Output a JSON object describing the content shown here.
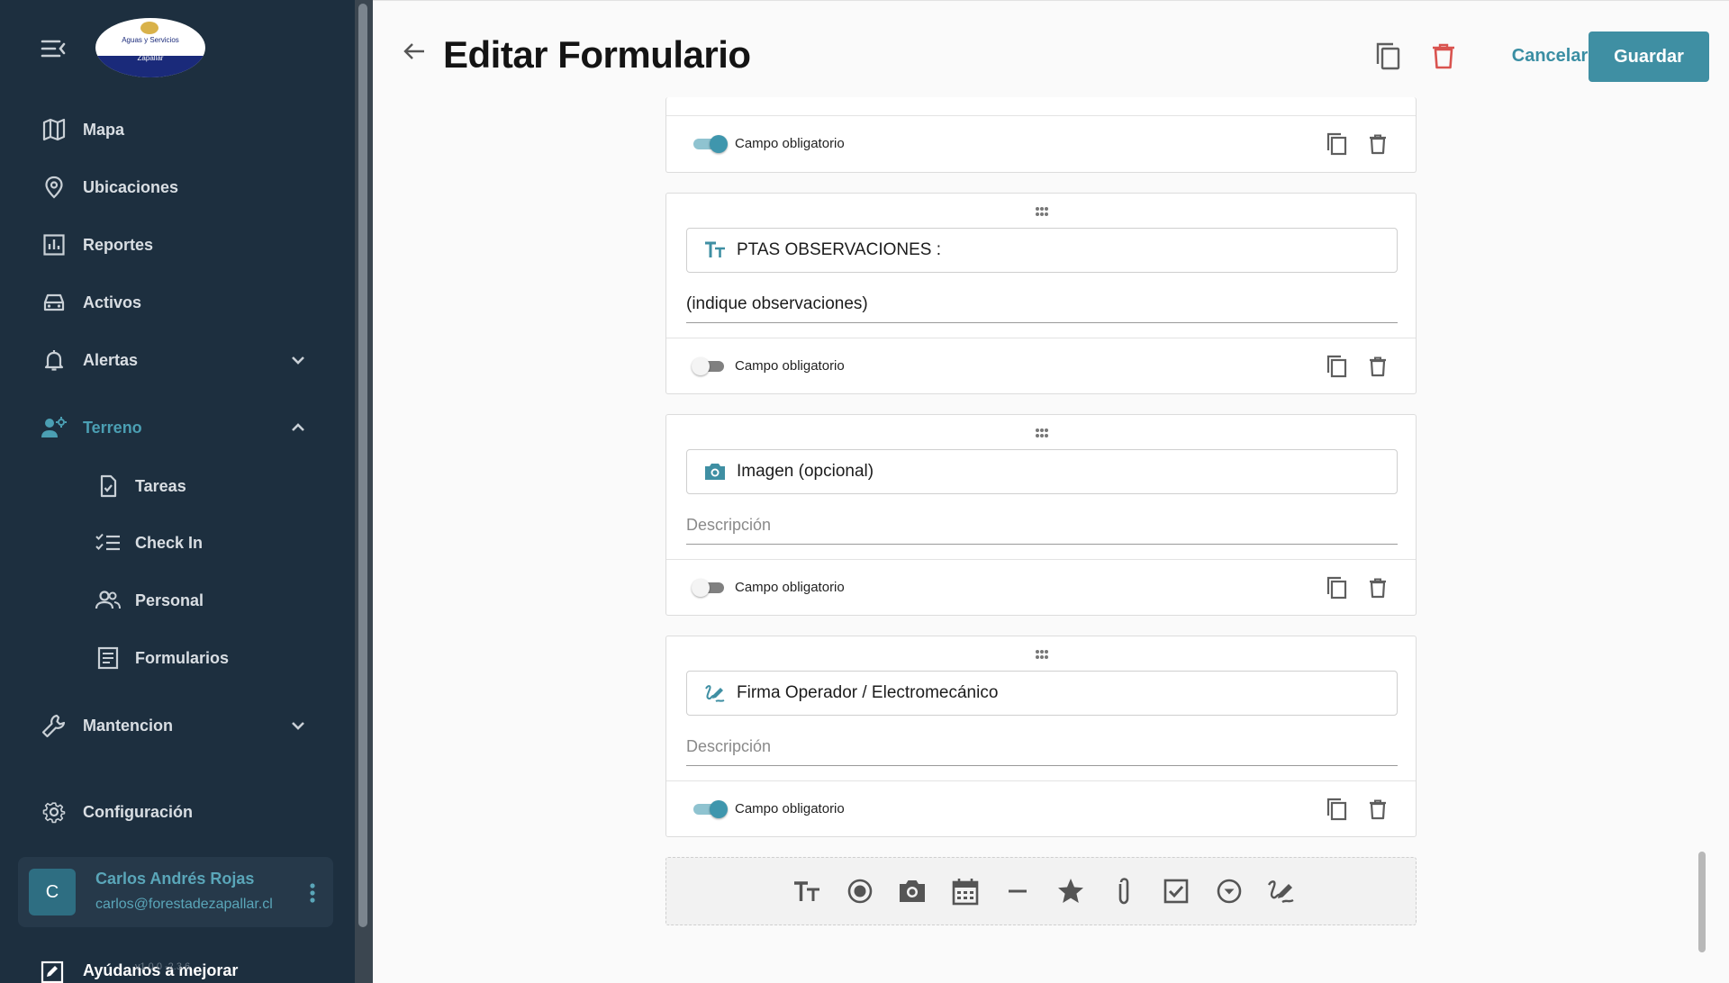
{
  "sidebar": {
    "logo": {
      "line1": "Aguas y Servicios",
      "line2": "Los Altos de",
      "line3": "Zapallar"
    },
    "nav": [
      {
        "label": "Mapa"
      },
      {
        "label": "Ubicaciones"
      },
      {
        "label": "Reportes"
      },
      {
        "label": "Activos"
      },
      {
        "label": "Alertas"
      },
      {
        "label": "Terreno"
      },
      {
        "label": "Tareas"
      },
      {
        "label": "Check In"
      },
      {
        "label": "Personal"
      },
      {
        "label": "Formularios"
      },
      {
        "label": "Mantencion"
      },
      {
        "label": "Configuración"
      }
    ],
    "user": {
      "initial": "C",
      "name": "Carlos Andrés Rojas",
      "email": "carlos@forestadezapallar.cl"
    },
    "help_label": "Ayúdanos a mejorar",
    "version": "v1.0.0 -2.3.6"
  },
  "header": {
    "title": "Editar Formulario",
    "cancel_label": "Cancelar",
    "save_label": "Guardar"
  },
  "form": {
    "required_label": "Campo obligatorio",
    "description_placeholder": "Descripción",
    "fields": [
      {
        "required": true
      },
      {
        "type": "text",
        "icon": "text-format-icon",
        "title": "PTAS OBSERVACIONES :",
        "description": "(indique observaciones)",
        "required": false
      },
      {
        "type": "image",
        "icon": "camera-icon",
        "title": "Imagen (opcional)",
        "description": "",
        "required": false
      },
      {
        "type": "signature",
        "icon": "signature-icon",
        "title": "Firma Operador / Electromecánico",
        "description": "",
        "required": true
      }
    ]
  },
  "toolbar": {
    "tools": [
      "text-format-icon",
      "radio-icon",
      "camera-icon",
      "calendar-icon",
      "divider-icon",
      "star-icon",
      "attachment-icon",
      "checkbox-icon",
      "dropdown-icon",
      "signature-icon"
    ]
  },
  "colors": {
    "sidebar_bg": "#1d2f3f",
    "accent": "#3f8fa3",
    "delete": "#d9534f"
  }
}
